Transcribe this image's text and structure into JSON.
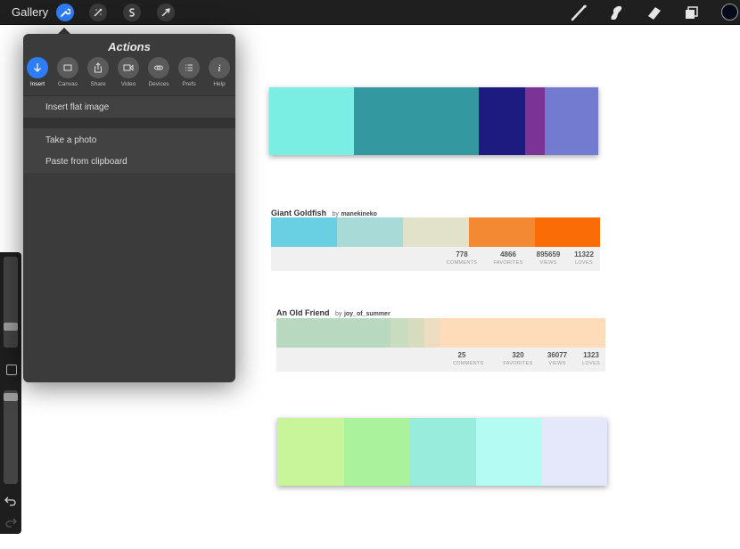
{
  "topbar": {
    "gallery_label": "Gallery",
    "left_tools": [
      "actions-icon",
      "adjustments-icon",
      "selection-icon",
      "transform-icon"
    ],
    "right_tools": [
      "brush-icon",
      "smudge-icon",
      "eraser-icon",
      "layers-icon"
    ],
    "current_color": "#050a1a"
  },
  "actions": {
    "title": "Actions",
    "tabs": [
      {
        "label": "Insert",
        "icon": "insert-icon",
        "active": true
      },
      {
        "label": "Canvas",
        "icon": "canvas-icon"
      },
      {
        "label": "Share",
        "icon": "share-icon"
      },
      {
        "label": "Video",
        "icon": "video-icon"
      },
      {
        "label": "Devices",
        "icon": "devices-icon"
      },
      {
        "label": "Prefs",
        "icon": "prefs-icon"
      },
      {
        "label": "Help",
        "icon": "help-icon"
      }
    ],
    "items": [
      "Insert flat image",
      "Take a photo",
      "Paste from clipboard"
    ]
  },
  "canvas": {
    "palette1": {
      "colors": [
        "#7aeee3",
        "#3398a0",
        "#1d1b80",
        "#7b3495",
        "#727bcf"
      ]
    },
    "palette2": {
      "title": "Giant Goldfish",
      "by": "by",
      "author": "manekineko",
      "colors": [
        "#69d0e4",
        "#a8dbd7",
        "#e1e2c9",
        "#f38a33",
        "#fa6c06"
      ],
      "stats": [
        {
          "value": "778",
          "label": "COMMENTS"
        },
        {
          "value": "4866",
          "label": "FAVORITES"
        },
        {
          "value": "895659",
          "label": "VIEWS"
        },
        {
          "value": "11322",
          "label": "LOVES"
        }
      ]
    },
    "palette3": {
      "title": "An Old Friend",
      "by": "by",
      "author": "joy_of_summer",
      "colors": [
        "#b8d8c0",
        "#c8dcc0",
        "#d8dcbf",
        "#eedcc0",
        "#fedbb9"
      ],
      "stats": [
        {
          "value": "25",
          "label": "COMMENTS"
        },
        {
          "value": "320",
          "label": "FAVORITES"
        },
        {
          "value": "36077",
          "label": "VIEWS"
        },
        {
          "value": "1323",
          "label": "LOVES"
        }
      ]
    },
    "palette4": {
      "colors": [
        "#c8f59a",
        "#aaf29b",
        "#98ecdc",
        "#b3fbf3",
        "#e5e8fb"
      ]
    }
  },
  "sidebar": {
    "undo_icon": "undo-icon",
    "redo_icon": "redo-icon"
  }
}
